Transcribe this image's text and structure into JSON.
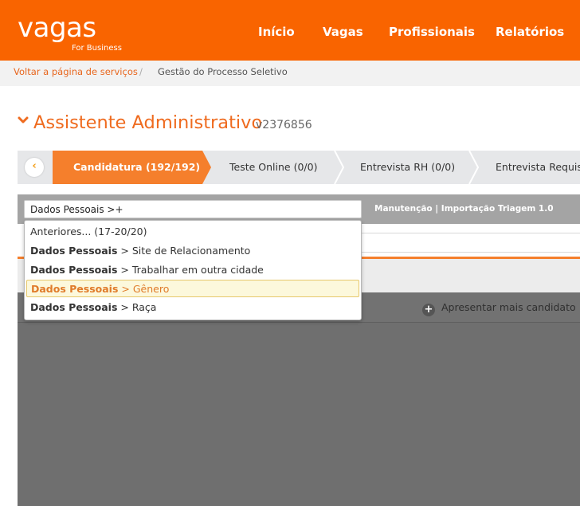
{
  "header": {
    "logo_main": "vagas",
    "logo_sub": "For Business",
    "nav": [
      "Início",
      "Vagas",
      "Profissionais",
      "Relatórios"
    ]
  },
  "breadcrumb": {
    "back_link": "Voltar a página de serviços",
    "separator": "/",
    "current": "Gestão do Processo Seletivo"
  },
  "job": {
    "title": "Assistente Administrativo",
    "code": "v2376856"
  },
  "stages": {
    "back_icon": "chevron-left-icon",
    "items": [
      {
        "label": "Candidatura (192/192)",
        "active": true
      },
      {
        "label": "Teste Online (0/0)",
        "active": false
      },
      {
        "label": "Entrevista RH (0/0)",
        "active": false
      },
      {
        "label": "Entrevista Requisi",
        "active": false
      }
    ]
  },
  "filter": {
    "search_value": "Dados Pessoais >+",
    "links": {
      "manutencao": "Manutenção",
      "separator": "|",
      "importacao": "Importação Triagem 1.0"
    }
  },
  "dropdown": {
    "previous": "Anteriores... (17-20/20)",
    "separator": ">",
    "items": [
      {
        "group": "Dados Pessoais",
        "option": "Site de Relacionamento",
        "highlighted": false
      },
      {
        "group": "Dados Pessoais",
        "option": "Trabalhar em outra cidade",
        "highlighted": false
      },
      {
        "group": "Dados Pessoais",
        "option": "Gênero",
        "highlighted": true
      },
      {
        "group": "Dados Pessoais",
        "option": "Raça",
        "highlighted": false
      }
    ]
  },
  "results": {
    "more_label": "Apresentar mais candidato",
    "more_icon": "plus-circle-icon"
  },
  "colors": {
    "brand_orange": "#f96400",
    "title_orange": "#ef6b1f",
    "active_stage": "#f57f2c",
    "highlight_bg": "#fcf8dc"
  }
}
